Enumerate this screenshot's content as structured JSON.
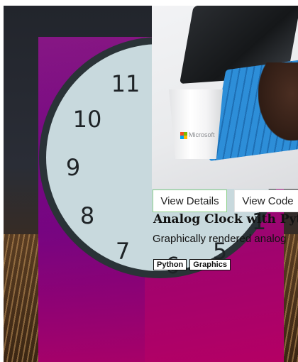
{
  "clock": {
    "numbers": [
      {
        "text": "11"
      },
      {
        "text": "10"
      },
      {
        "text": "9"
      },
      {
        "text": "8"
      },
      {
        "text": "7"
      },
      {
        "text": "6"
      },
      {
        "text": "5"
      },
      {
        "text": "1"
      }
    ]
  },
  "photo": {
    "cup_brand": "Microsoft"
  },
  "card": {
    "details_label": "View Details",
    "code_label": "View Code",
    "title": "Analog Clock with Python",
    "description": "Graphically rendered analog",
    "tags": [
      "Python",
      "Graphics"
    ]
  },
  "colors": {
    "accent_border": "#8fd18b",
    "gradient_start": "#8e1b86",
    "gradient_end": "#b40064"
  }
}
